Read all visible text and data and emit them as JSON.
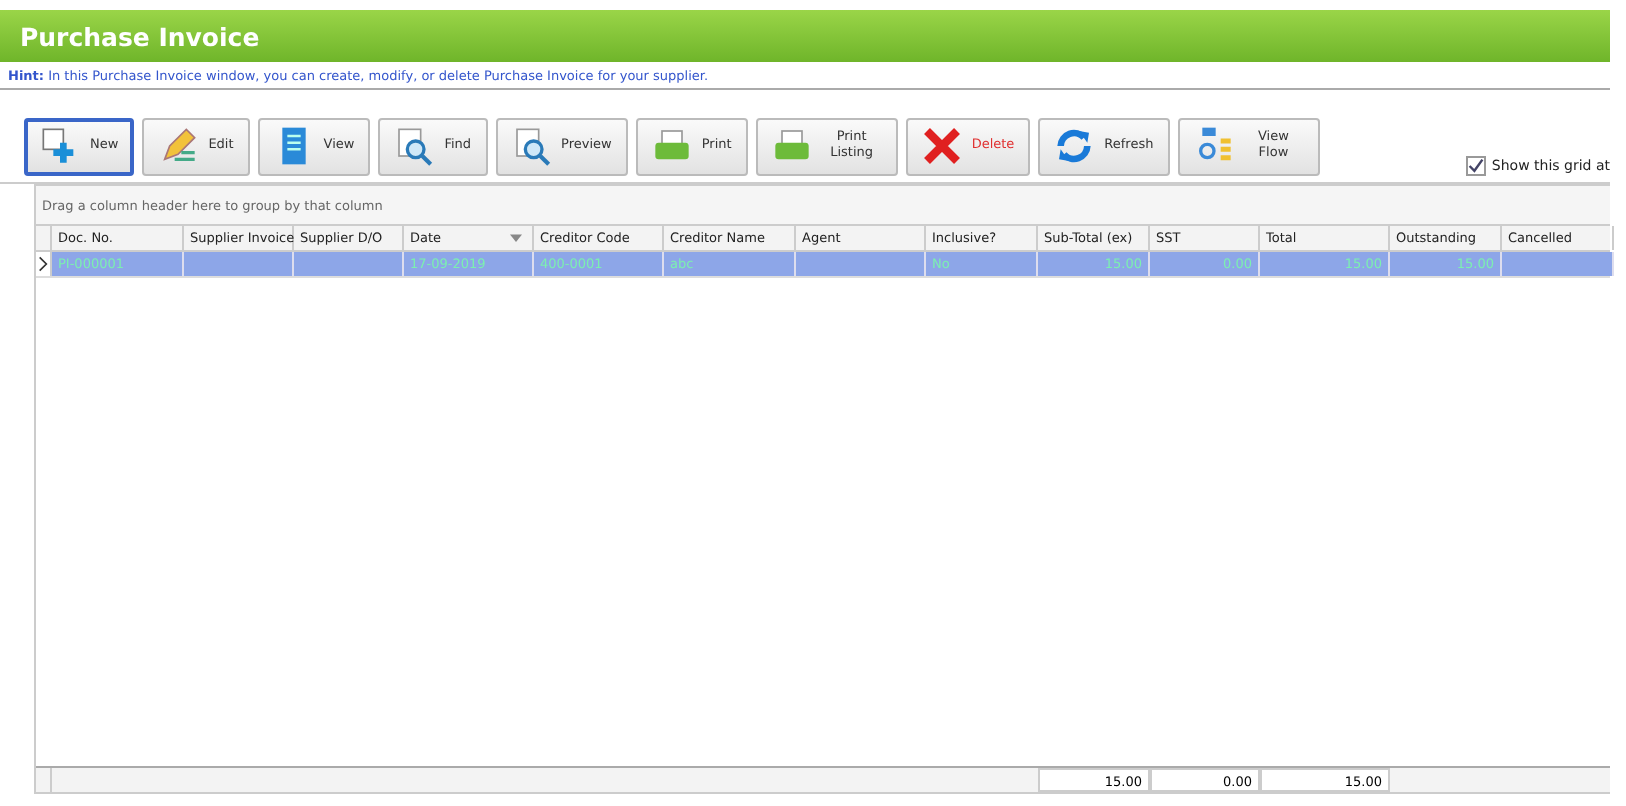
{
  "window": {
    "title": "Purchase Invoice"
  },
  "hint": {
    "label": "Hint:",
    "text": "In this Purchase Invoice window, you can create, modify, or delete Purchase Invoice for your supplier."
  },
  "toolbar": [
    {
      "label": "New",
      "selected": true,
      "kind": "normal"
    },
    {
      "label": "Edit",
      "selected": false,
      "kind": "normal"
    },
    {
      "label": "View",
      "selected": false,
      "kind": "normal"
    },
    {
      "label": "Find",
      "selected": false,
      "kind": "normal"
    },
    {
      "label": "Preview",
      "selected": false,
      "kind": "normal"
    },
    {
      "label": "Print",
      "selected": false,
      "kind": "normal"
    },
    {
      "label": "Print Listing",
      "selected": false,
      "kind": "normal"
    },
    {
      "label": "Delete",
      "selected": false,
      "kind": "danger"
    },
    {
      "label": "Refresh",
      "selected": false,
      "kind": "normal"
    },
    {
      "label": "View Flow",
      "selected": false,
      "kind": "normal"
    }
  ],
  "show_grid_checkbox": {
    "label": "Show this grid at",
    "checked": true
  },
  "group_panel": "Drag a column header here to group by that column",
  "table": {
    "columns": [
      {
        "label": "Doc. No.",
        "sorted": false
      },
      {
        "label": "Supplier Invoice",
        "sorted": false
      },
      {
        "label": "Supplier D/O",
        "sorted": false
      },
      {
        "label": "Date",
        "sorted": true
      },
      {
        "label": "Creditor Code",
        "sorted": false
      },
      {
        "label": "Creditor Name",
        "sorted": false
      },
      {
        "label": "Agent",
        "sorted": false
      },
      {
        "label": "Inclusive?",
        "sorted": false
      },
      {
        "label": "Sub-Total (ex)",
        "sorted": false
      },
      {
        "label": "SST",
        "sorted": false
      },
      {
        "label": "Total",
        "sorted": false
      },
      {
        "label": "Outstanding",
        "sorted": false
      },
      {
        "label": "Cancelled",
        "sorted": false
      }
    ],
    "rows": [
      {
        "selected": true,
        "cells": [
          "PI-000001",
          "",
          "",
          "17-09-2019",
          "400-0001",
          "abc",
          "",
          "No",
          "15.00",
          "0.00",
          "15.00",
          "15.00",
          ""
        ]
      }
    ],
    "footer": {
      "sub_total": "15.00",
      "sst": "0.00",
      "total": "15.00"
    }
  }
}
